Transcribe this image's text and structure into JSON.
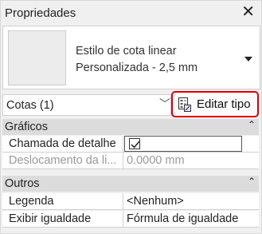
{
  "window": {
    "title": "Propriedades"
  },
  "type_selector": {
    "family": "Estilo de cota linear",
    "type": "Personalizada - 2,5 mm"
  },
  "instance": {
    "filter_label": "Cotas (1)",
    "edit_type_label": "Editar tipo"
  },
  "sections": [
    {
      "label": "Gráficos",
      "toggle": "⌃",
      "rows": [
        {
          "name": "Chamada de detalhe",
          "value": "",
          "checked": true
        },
        {
          "name": "Deslocamento da li...",
          "value": "0.0000 mm"
        }
      ]
    },
    {
      "label": "Outros",
      "toggle": "⌃",
      "rows": [
        {
          "name": "Legenda",
          "value": "<Nenhum>"
        },
        {
          "name": "Exibir igualdade",
          "value": "Fórmula de igualdade"
        }
      ]
    }
  ],
  "colors": {
    "highlight": "#e00000",
    "section_bg": "#dcdcdc"
  }
}
